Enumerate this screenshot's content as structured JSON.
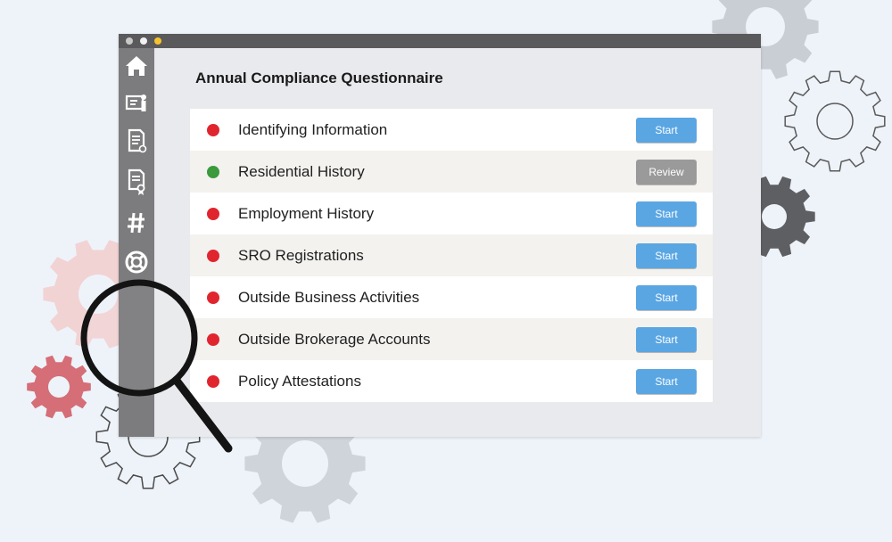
{
  "colors": {
    "status_incomplete": "#e0252f",
    "status_complete": "#3a9a3c",
    "start_button": "#5aa6e3",
    "review_button": "#9a9a9a",
    "sidebar": "#7c7c7e",
    "titlebar": "#5a5a5c"
  },
  "window": {
    "controls": [
      "window-dot-gray",
      "window-dot-white",
      "window-dot-yellow"
    ]
  },
  "sidebar": {
    "items": [
      {
        "icon": "home-icon"
      },
      {
        "icon": "profile-card-icon"
      },
      {
        "icon": "document-icon"
      },
      {
        "icon": "certificate-icon"
      },
      {
        "icon": "hashtag-icon"
      },
      {
        "icon": "lifebuoy-icon"
      }
    ]
  },
  "main": {
    "title": "Annual Compliance Questionnaire",
    "sections": [
      {
        "label": "Identifying Information",
        "status": "incomplete",
        "action": "Start"
      },
      {
        "label": "Residential History",
        "status": "complete",
        "action": "Review"
      },
      {
        "label": "Employment History",
        "status": "incomplete",
        "action": "Start"
      },
      {
        "label": "SRO Registrations",
        "status": "incomplete",
        "action": "Start"
      },
      {
        "label": "Outside Business Activities",
        "status": "incomplete",
        "action": "Start"
      },
      {
        "label": "Outside Brokerage Accounts",
        "status": "incomplete",
        "action": "Start"
      },
      {
        "label": "Policy Attestations",
        "status": "incomplete",
        "action": "Start"
      }
    ]
  }
}
